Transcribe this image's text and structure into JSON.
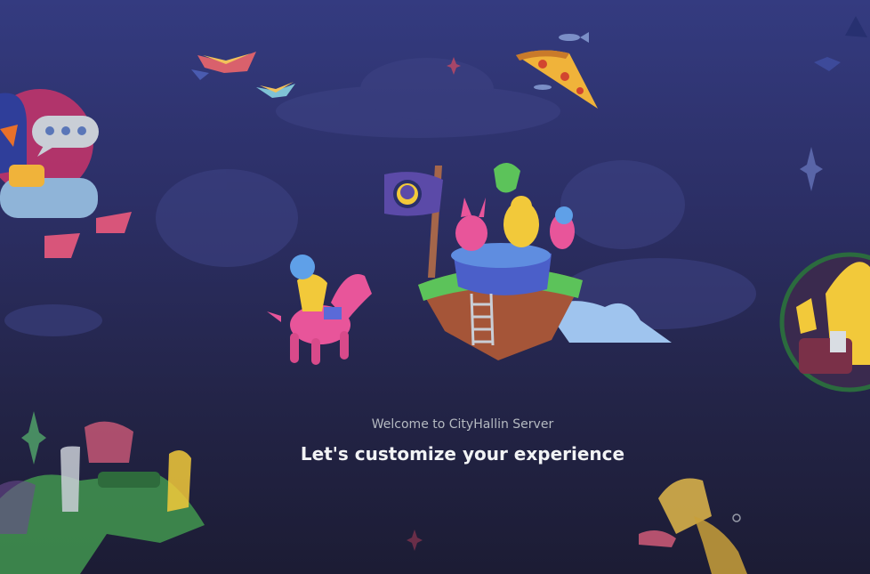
{
  "onboarding": {
    "welcome_text": "Welcome to CityHallin Server",
    "headline": "Let's customize your experience"
  },
  "illustration": {
    "icons": [
      "floating-island-icon",
      "pirate-flag-icon",
      "pink-horse-rider-icon",
      "pizza-slice-icon",
      "book-icon",
      "speech-bubble-icon",
      "gramophone-icon",
      "crocodile-icon",
      "sparkle-icon"
    ]
  },
  "colors": {
    "background_top": "#343b80",
    "background_bottom": "#1c1c34",
    "text_muted": "#b5bac1",
    "text_primary": "#f2f3f5"
  }
}
